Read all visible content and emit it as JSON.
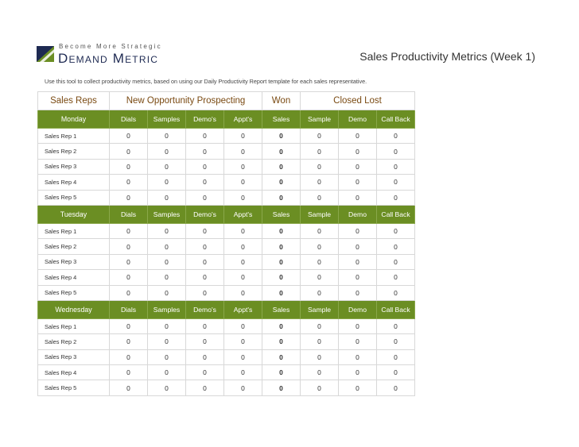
{
  "logo": {
    "tagline": "Become More Strategic",
    "brand": "Demand Metric",
    "mark_color": "#1e2a52",
    "accent_color": "#6b8e23"
  },
  "title": "Sales Productivity Metrics (Week 1)",
  "intro": "Use this tool to collect productivity metrics, based on using our Daily Productivity Report template for each sales representative.",
  "category_headers": [
    "Sales Reps",
    "New Opportunity Prospecting",
    "Won",
    "Closed Lost"
  ],
  "column_headers": [
    "Dials",
    "Samples",
    "Demo's",
    "Appt's",
    "Sales",
    "Sample",
    "Demo",
    "Call Back"
  ],
  "header_color": "#6b8e23",
  "days": [
    {
      "name": "Monday",
      "rows": [
        {
          "rep": "Sales Rep 1",
          "values": [
            "0",
            "0",
            "0",
            "0",
            "0",
            "0",
            "0",
            "0"
          ]
        },
        {
          "rep": "Sales Rep 2",
          "values": [
            "0",
            "0",
            "0",
            "0",
            "0",
            "0",
            "0",
            "0"
          ]
        },
        {
          "rep": "Sales Rep 3",
          "values": [
            "0",
            "0",
            "0",
            "0",
            "0",
            "0",
            "0",
            "0"
          ]
        },
        {
          "rep": "Sales Rep 4",
          "values": [
            "0",
            "0",
            "0",
            "0",
            "0",
            "0",
            "0",
            "0"
          ]
        },
        {
          "rep": "Sales Rep 5",
          "values": [
            "0",
            "0",
            "0",
            "0",
            "0",
            "0",
            "0",
            "0"
          ]
        }
      ]
    },
    {
      "name": "Tuesday",
      "rows": [
        {
          "rep": "Sales Rep 1",
          "values": [
            "0",
            "0",
            "0",
            "0",
            "0",
            "0",
            "0",
            "0"
          ]
        },
        {
          "rep": "Sales Rep 2",
          "values": [
            "0",
            "0",
            "0",
            "0",
            "0",
            "0",
            "0",
            "0"
          ]
        },
        {
          "rep": "Sales Rep 3",
          "values": [
            "0",
            "0",
            "0",
            "0",
            "0",
            "0",
            "0",
            "0"
          ]
        },
        {
          "rep": "Sales Rep 4",
          "values": [
            "0",
            "0",
            "0",
            "0",
            "0",
            "0",
            "0",
            "0"
          ]
        },
        {
          "rep": "Sales Rep 5",
          "values": [
            "0",
            "0",
            "0",
            "0",
            "0",
            "0",
            "0",
            "0"
          ]
        }
      ]
    },
    {
      "name": "Wednesday",
      "rows": [
        {
          "rep": "Sales Rep 1",
          "values": [
            "0",
            "0",
            "0",
            "0",
            "0",
            "0",
            "0",
            "0"
          ]
        },
        {
          "rep": "Sales Rep 2",
          "values": [
            "0",
            "0",
            "0",
            "0",
            "0",
            "0",
            "0",
            "0"
          ]
        },
        {
          "rep": "Sales Rep 3",
          "values": [
            "0",
            "0",
            "0",
            "0",
            "0",
            "0",
            "0",
            "0"
          ]
        },
        {
          "rep": "Sales Rep 4",
          "values": [
            "0",
            "0",
            "0",
            "0",
            "0",
            "0",
            "0",
            "0"
          ]
        },
        {
          "rep": "Sales Rep 5",
          "values": [
            "0",
            "0",
            "0",
            "0",
            "0",
            "0",
            "0",
            "0"
          ]
        }
      ]
    }
  ]
}
